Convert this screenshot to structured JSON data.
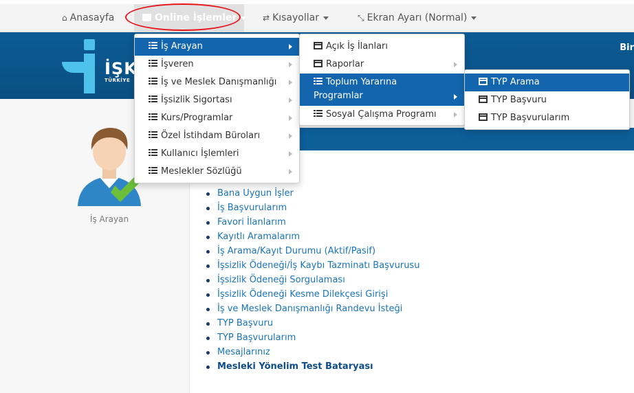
{
  "nav": {
    "home": "Anasayfa",
    "online": "Online İşlemler",
    "shortcuts": "Kısayollar",
    "screen": "Ekran Ayarı (Normal)"
  },
  "banner": {
    "logo_text": "İŞK",
    "logo_sub": "TÜRKİYE",
    "right_text": "Bir"
  },
  "menu1": {
    "items": [
      "İş Arayan",
      "İşveren",
      "İş ve Meslek Danışmanlığı",
      "İşsizlik Sigortası",
      "Kurs/Programlar",
      "Özel İstihdam Büroları",
      "Kullanıcı İşlemleri",
      "Meslekler Sözlüğü"
    ]
  },
  "menu2": {
    "items": [
      "Açık İş İlanları",
      "Raporlar",
      "Toplum Yararına",
      "Programlar",
      "Sosyal Çalışma Programı"
    ]
  },
  "menu3": {
    "items": [
      "TYP Arama",
      "TYP Başvuru",
      "TYP Başvurularım"
    ]
  },
  "avatar_label": "İş Arayan",
  "links": [
    "Bana Uygun İşler",
    "İş Başvurularım",
    "Favori İlanlarım",
    "Kayıtlı Aramalarım",
    "İş Arama/Kayıt Durumu (Aktif/Pasif)",
    "İşsizlik Ödeneği/İş Kaybı Tazminatı Başvurusu",
    "İşsizlik Ödeneği Sorgulaması",
    "İşsizlik Ödeneği Kesme Dilekçesi Girişi",
    "İş ve Meslek Danışmanlığı Randevu İsteği",
    "TYP Başvuru",
    "TYP Başvurularım",
    "Mesajlarınız",
    "Mesleki Yönelim Test Bataryası"
  ],
  "colors": {
    "brand_blue": "#0b5b94",
    "selected": "#1366ad",
    "link": "#1a74b8",
    "annotation": "#e8141b"
  }
}
